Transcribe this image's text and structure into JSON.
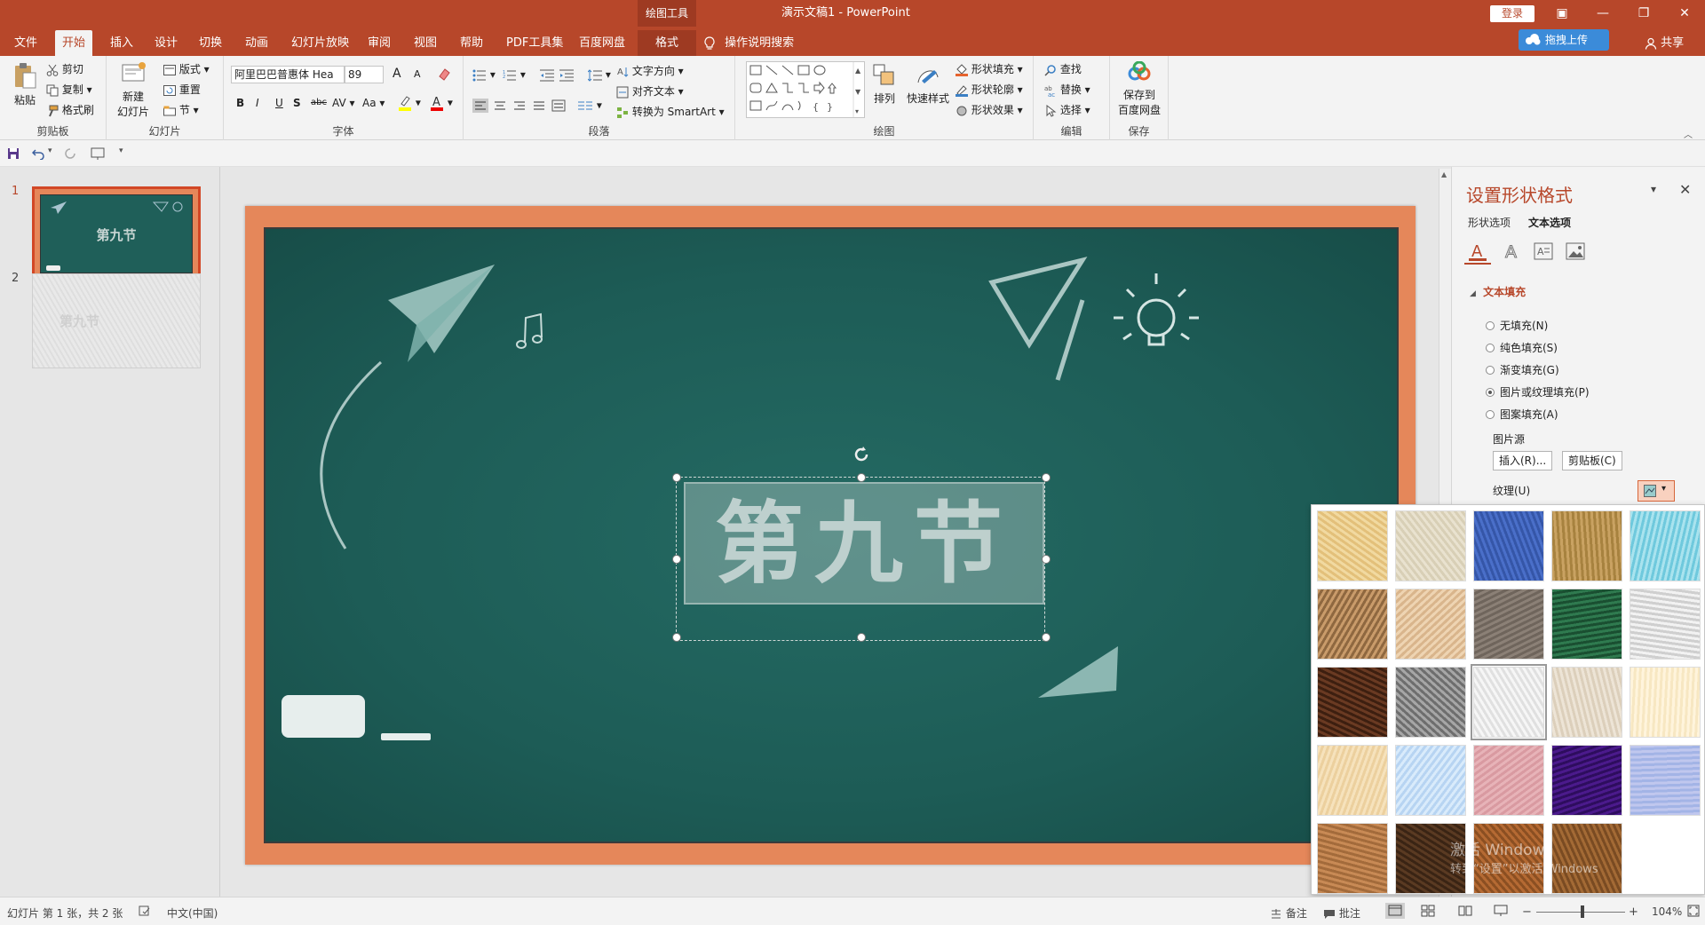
{
  "window": {
    "context_tab": "绘图工具",
    "title": "演示文稿1  -  PowerPoint",
    "login": "登录",
    "minimize": "—",
    "restore": "❐",
    "close": "✕",
    "display_options": "▣"
  },
  "tabs": [
    {
      "label": "文件"
    },
    {
      "label": "开始"
    },
    {
      "label": "插入"
    },
    {
      "label": "设计"
    },
    {
      "label": "切换"
    },
    {
      "label": "动画"
    },
    {
      "label": "幻灯片放映"
    },
    {
      "label": "审阅"
    },
    {
      "label": "视图"
    },
    {
      "label": "帮助"
    },
    {
      "label": "PDF工具集"
    },
    {
      "label": "百度网盘"
    },
    {
      "label": "格式"
    }
  ],
  "tell_me": "操作说明搜索",
  "upload": "拖拽上传",
  "share": "共享",
  "ribbon": {
    "clipboard": {
      "paste": "粘贴",
      "cut": "剪切",
      "copy": "复制",
      "format_painter": "格式刷",
      "label": "剪贴板"
    },
    "slides": {
      "new_slide_1": "新建",
      "new_slide_2": "幻灯片",
      "layout": "版式",
      "reset": "重置",
      "section": "节",
      "label": "幻灯片"
    },
    "font": {
      "name": "阿里巴巴普惠体 Hea",
      "size": "89",
      "label": "字体",
      "bold": "B",
      "italic": "I",
      "underline": "U",
      "shadow": "S",
      "strike": "abc",
      "spacing": "AV",
      "case": "Aa",
      "grow": "A",
      "shrink": "A"
    },
    "paragraph": {
      "text_direction": "文字方向",
      "align_text": "对齐文本",
      "smartart": "转换为 SmartArt",
      "label": "段落"
    },
    "drawing": {
      "arrange": "排列",
      "quick_styles": "快速样式",
      "shape_fill": "形状填充",
      "shape_outline": "形状轮廓",
      "shape_effects": "形状效果",
      "label": "绘图"
    },
    "editing": {
      "find": "查找",
      "replace": "替换",
      "select": "选择",
      "label": "编辑"
    },
    "save": {
      "line1": "保存到",
      "line2": "百度网盘",
      "label": "保存"
    }
  },
  "thumbnails": [
    {
      "number": "1",
      "title": "第九节"
    },
    {
      "number": "2",
      "title": "第九节"
    }
  ],
  "slide": {
    "title": "第九节"
  },
  "pane": {
    "title": "设置形状格式",
    "tab_shape": "形状选项",
    "tab_text": "文本选项",
    "section": "文本填充",
    "options": [
      {
        "label": "无填充(N)",
        "selected": false
      },
      {
        "label": "纯色填充(S)",
        "selected": false
      },
      {
        "label": "渐变填充(G)",
        "selected": false
      },
      {
        "label": "图片或纹理填充(P)",
        "selected": true
      },
      {
        "label": "图案填充(A)",
        "selected": false
      }
    ],
    "picture_source": "图片源",
    "insert": "插入(R)...",
    "clipboard": "剪贴板(C)",
    "texture": "纹理(U)"
  },
  "watermark": {
    "line1": "激活 Windows",
    "line2": "转到“设置”以激活 Windows"
  },
  "textures": [
    {
      "name": "papyrus",
      "c1": "#f1d9a0",
      "c2": "#e3c07a"
    },
    {
      "name": "canvas",
      "c1": "#e9e2cf",
      "c2": "#d8cfb6"
    },
    {
      "name": "denim",
      "c1": "#4a6fc9",
      "c2": "#3556a8"
    },
    {
      "name": "woven-mat",
      "c1": "#c9a262",
      "c2": "#a7823f"
    },
    {
      "name": "water-droplets",
      "c1": "#a9e3ee",
      "c2": "#6fc9dd"
    },
    {
      "name": "paper-bag",
      "c1": "#c99b6a",
      "c2": "#8f6840"
    },
    {
      "name": "fish-fossil",
      "c1": "#eed4b2",
      "c2": "#d9b58c"
    },
    {
      "name": "sand",
      "c1": "#8b8076",
      "c2": "#6f655c"
    },
    {
      "name": "green-marble",
      "c1": "#2f7a4f",
      "c2": "#1a4f31"
    },
    {
      "name": "white-marble",
      "c1": "#f2f2f2",
      "c2": "#cfcfcf"
    },
    {
      "name": "brown-marble",
      "c1": "#6a3a22",
      "c2": "#3d1f10"
    },
    {
      "name": "granite",
      "c1": "#a6a6a6",
      "c2": "#6e6e6e"
    },
    {
      "name": "newsprint",
      "c1": "#f6f6f6",
      "c2": "#e0e0e0"
    },
    {
      "name": "recycled-paper",
      "c1": "#ede4d6",
      "c2": "#dccfbb"
    },
    {
      "name": "parchment",
      "c1": "#fff4dc",
      "c2": "#f7e7c2"
    },
    {
      "name": "stationery",
      "c1": "#f6e2bc",
      "c2": "#ecd09e"
    },
    {
      "name": "blue-tissue",
      "c1": "#d9ebfb",
      "c2": "#b7d4f2"
    },
    {
      "name": "pink-tissue",
      "c1": "#e7b3b8",
      "c2": "#d99aa1"
    },
    {
      "name": "purple-mesh",
      "c1": "#4b1a8c",
      "c2": "#2e0d5e"
    },
    {
      "name": "bouquet",
      "c1": "#c0c7ee",
      "c2": "#a3b4e6"
    },
    {
      "name": "cork",
      "c1": "#c88a55",
      "c2": "#a36b3b"
    },
    {
      "name": "walnut",
      "c1": "#5a3a22",
      "c2": "#3a2414"
    },
    {
      "name": "oak",
      "c1": "#b56a33",
      "c2": "#8b4f22"
    },
    {
      "name": "medium-wood",
      "c1": "#a36a35",
      "c2": "#7a4b22"
    }
  ],
  "status": {
    "slide_info": "幻灯片 第 1 张，共 2 张",
    "language": "中文(中国)",
    "notes": "备注",
    "comments": "批注",
    "zoom": "104%",
    "zoom_level": 0.52
  }
}
